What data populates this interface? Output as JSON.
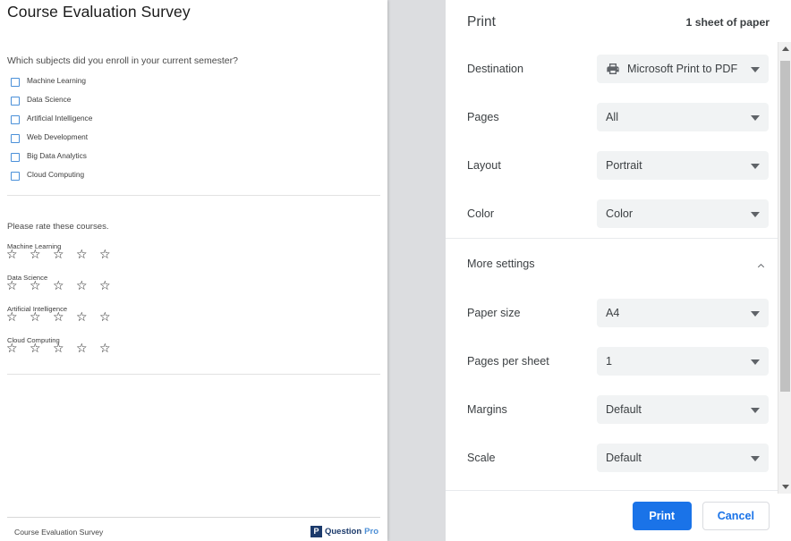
{
  "document": {
    "title": "Course Evaluation Survey",
    "question": "Which subjects did you enroll in your current semester?",
    "checkbox_options": [
      "Machine Learning",
      "Data Science",
      "Artificial Intelligence",
      "Web Development",
      "Big Data Analytics",
      "Cloud  Computing"
    ],
    "rating_prompt": "Please rate these courses.",
    "rating_items": [
      {
        "name": "Machine Learning",
        "stars": "☆ ☆ ☆ ☆ ☆",
        "max_stars": 5,
        "selected": 0
      },
      {
        "name": "Data Science",
        "stars": "☆ ☆ ☆ ☆ ☆",
        "max_stars": 5,
        "selected": 0
      },
      {
        "name": "Artificial Intelligence",
        "stars": "☆ ☆ ☆ ☆ ☆",
        "max_stars": 5,
        "selected": 0
      },
      {
        "name": "Cloud Computing",
        "stars": "☆ ☆ ☆ ☆ ☆",
        "max_stars": 5,
        "selected": 0
      }
    ],
    "footer_text": "Course Evaluation Survey",
    "logo": {
      "mark": "P",
      "word_primary": "Question",
      "word_secondary": "Pro",
      "color_primary": "#1b3a6b",
      "color_secondary": "#4d8fd6"
    }
  },
  "print_dialog": {
    "title": "Print",
    "sheet_summary": "1 sheet of paper",
    "settings": [
      {
        "label": "Destination",
        "value": "Microsoft Print to PDF",
        "icon": "printer-icon"
      },
      {
        "label": "Pages",
        "value": "All",
        "icon": null
      },
      {
        "label": "Layout",
        "value": "Portrait",
        "icon": null
      },
      {
        "label": "Color",
        "value": "Color",
        "icon": null
      }
    ],
    "more_settings": {
      "label": "More settings",
      "expanded": true,
      "icon": "chevron-up-icon"
    },
    "advanced_settings": [
      {
        "label": "Paper size",
        "value": "A4"
      },
      {
        "label": "Pages per sheet",
        "value": "1"
      },
      {
        "label": "Margins",
        "value": "Default"
      },
      {
        "label": "Scale",
        "value": "Default"
      }
    ],
    "buttons": {
      "print": "Print",
      "cancel": "Cancel"
    },
    "accent_color": "#1a73e8"
  }
}
